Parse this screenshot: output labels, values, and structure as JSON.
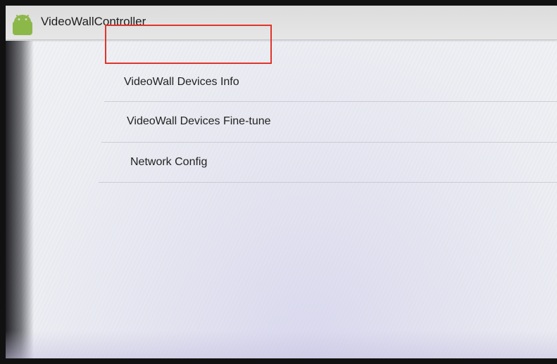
{
  "app": {
    "title": "VideoWallController",
    "icon": "android-icon",
    "icon_color": "#8cb84a"
  },
  "menu": {
    "items": [
      {
        "label": "VideoWall Devices Info",
        "highlighted": true
      },
      {
        "label": "VideoWall Devices Fine-tune",
        "highlighted": false
      },
      {
        "label": "Network Config",
        "highlighted": false
      }
    ]
  },
  "annotation": {
    "highlight_color": "#e0352b"
  }
}
